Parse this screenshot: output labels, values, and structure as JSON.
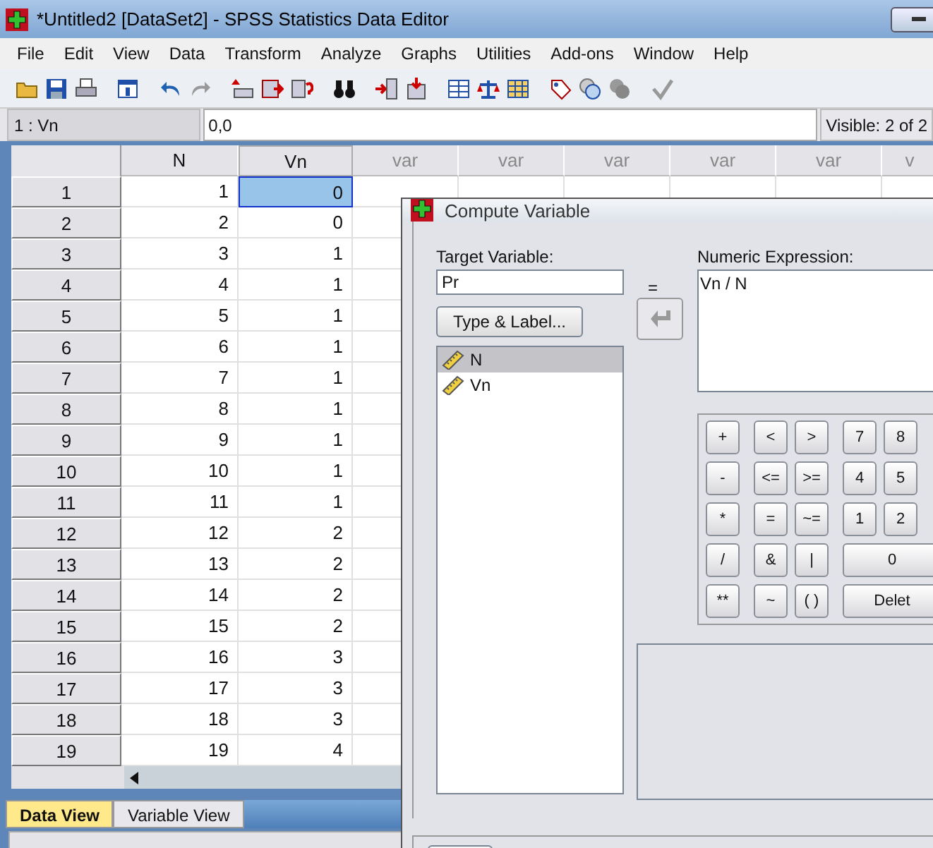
{
  "window": {
    "title": "*Untitled2 [DataSet2] - SPSS Statistics Data Editor"
  },
  "menu": [
    "File",
    "Edit",
    "View",
    "Data",
    "Transform",
    "Analyze",
    "Graphs",
    "Utilities",
    "Add-ons",
    "Window",
    "Help"
  ],
  "cell_editor": {
    "reference": "1 : Vn",
    "value": "0,0",
    "visible": "Visible: 2 of 2"
  },
  "table": {
    "columns": [
      "N",
      "Vn",
      "var",
      "var",
      "var",
      "var",
      "var",
      "v"
    ],
    "rows": [
      {
        "case": "1",
        "n": "1",
        "vn": "0",
        "selected": true
      },
      {
        "case": "2",
        "n": "2",
        "vn": "0",
        "selected": false
      },
      {
        "case": "3",
        "n": "3",
        "vn": "1",
        "selected": false
      },
      {
        "case": "4",
        "n": "4",
        "vn": "1",
        "selected": false
      },
      {
        "case": "5",
        "n": "5",
        "vn": "1",
        "selected": false
      },
      {
        "case": "6",
        "n": "6",
        "vn": "1",
        "selected": false
      },
      {
        "case": "7",
        "n": "7",
        "vn": "1",
        "selected": false
      },
      {
        "case": "8",
        "n": "8",
        "vn": "1",
        "selected": false
      },
      {
        "case": "9",
        "n": "9",
        "vn": "1",
        "selected": false
      },
      {
        "case": "10",
        "n": "10",
        "vn": "1",
        "selected": false
      },
      {
        "case": "11",
        "n": "11",
        "vn": "1",
        "selected": false
      },
      {
        "case": "12",
        "n": "12",
        "vn": "2",
        "selected": false
      },
      {
        "case": "13",
        "n": "13",
        "vn": "2",
        "selected": false
      },
      {
        "case": "14",
        "n": "14",
        "vn": "2",
        "selected": false
      },
      {
        "case": "15",
        "n": "15",
        "vn": "2",
        "selected": false
      },
      {
        "case": "16",
        "n": "16",
        "vn": "3",
        "selected": false
      },
      {
        "case": "17",
        "n": "17",
        "vn": "3",
        "selected": false
      },
      {
        "case": "18",
        "n": "18",
        "vn": "3",
        "selected": false
      },
      {
        "case": "19",
        "n": "19",
        "vn": "4",
        "selected": false
      }
    ]
  },
  "tabs": [
    {
      "label": "Data View",
      "selected": true
    },
    {
      "label": "Variable View",
      "selected": false
    }
  ],
  "dialog": {
    "title": "Compute Variable",
    "target_label": "Target Variable:",
    "target_value": "Pr",
    "equals": "=",
    "expression_label": "Numeric Expression:",
    "expression_value": "Vn / N",
    "type_label_button": "Type & Label...",
    "variables": [
      {
        "name": "N",
        "selected": true
      },
      {
        "name": "Vn",
        "selected": false
      }
    ],
    "keypad": [
      [
        {
          "label": "+",
          "kind": "key"
        },
        {
          "label": "<",
          "kind": "key"
        },
        {
          "label": ">",
          "kind": "key"
        },
        {
          "label": "7",
          "kind": "key"
        },
        {
          "label": "8",
          "kind": "key"
        }
      ],
      [
        {
          "label": "-",
          "kind": "key"
        },
        {
          "label": "<=",
          "kind": "key"
        },
        {
          "label": ">=",
          "kind": "key"
        },
        {
          "label": "4",
          "kind": "key"
        },
        {
          "label": "5",
          "kind": "key"
        }
      ],
      [
        {
          "label": "*",
          "kind": "key"
        },
        {
          "label": "=",
          "kind": "key"
        },
        {
          "label": "~=",
          "kind": "key"
        },
        {
          "label": "1",
          "kind": "key"
        },
        {
          "label": "2",
          "kind": "key"
        }
      ],
      [
        {
          "label": "/",
          "kind": "key"
        },
        {
          "label": "&",
          "kind": "key"
        },
        {
          "label": "|",
          "kind": "key"
        },
        {
          "label": "0",
          "kind": "wide"
        }
      ],
      [
        {
          "label": "**",
          "kind": "key"
        },
        {
          "label": "~",
          "kind": "key"
        },
        {
          "label": "( )",
          "kind": "key"
        },
        {
          "label": "Delet",
          "kind": "wide"
        }
      ]
    ]
  }
}
